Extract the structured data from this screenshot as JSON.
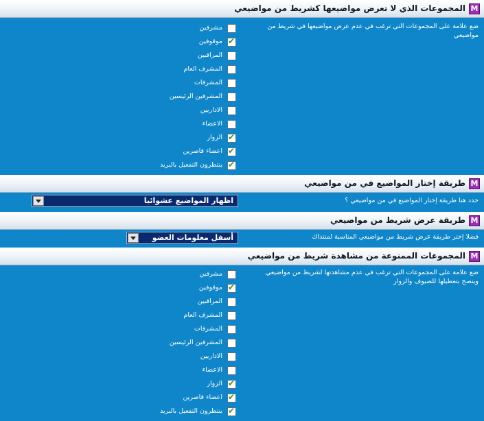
{
  "sections": [
    {
      "title": "المجموعات الذي لا تعرض مواضيعها كشريط من مواضيعي",
      "description": "ضع علامة على المجموعات التي ترغب في عدم عرض مواضيعها في شريط من مواضيعي"
    },
    {
      "title": "طريقة إختار المواضيع في من مواضيعي",
      "description": "حدد هنا طريقة إختار المواضيع في من مواضيعي ؟"
    },
    {
      "title": "طريقة عرض شريط من مواضيعي",
      "description": "فضلا إختر طريقة عرض شريط من مواضيعي المناسبة لمنتداك"
    },
    {
      "title": "المجموعات الممنوعة من مشاهدة شريط من مواضيعي",
      "description": "ضع علامة على المجموعات التي ترغب في عدم مشاهدتها لشريط من مواضيعي وينصح بتعطيلها للضيوف والزوار"
    }
  ],
  "checkboxes_1": [
    {
      "label": "مشرفين",
      "checked": false
    },
    {
      "label": "موقوفين",
      "checked": true
    },
    {
      "label": "المراقبين",
      "checked": false
    },
    {
      "label": "المشرف العام",
      "checked": false
    },
    {
      "label": "المشرفات",
      "checked": false
    },
    {
      "label": "المشرفين الرئيسين",
      "checked": false
    },
    {
      "label": "الاداريين",
      "checked": false
    },
    {
      "label": "الاعضاء",
      "checked": false
    },
    {
      "label": "الزوار",
      "checked": true
    },
    {
      "label": "اعضاء قاصرين",
      "checked": true
    },
    {
      "label": "ينتظرون التفعيل بالبريد",
      "checked": true
    }
  ],
  "checkboxes_2": [
    {
      "label": "مشرفين",
      "checked": false
    },
    {
      "label": "موقوفين",
      "checked": true
    },
    {
      "label": "المراقبين",
      "checked": false
    },
    {
      "label": "المشرف العام",
      "checked": false
    },
    {
      "label": "المشرفات",
      "checked": false
    },
    {
      "label": "المشرفين الرئيسين",
      "checked": false
    },
    {
      "label": "الاداريين",
      "checked": false
    },
    {
      "label": "الاعضاء",
      "checked": false
    },
    {
      "label": "الزوار",
      "checked": true
    },
    {
      "label": "اعضاء قاصرين",
      "checked": true
    },
    {
      "label": "ينتظرون التفعيل بالبريد",
      "checked": true
    }
  ],
  "select_method": {
    "value": "اظهار المواضيع عشوائيا"
  },
  "select_display": {
    "value": "أسفل معلومات العضو"
  }
}
